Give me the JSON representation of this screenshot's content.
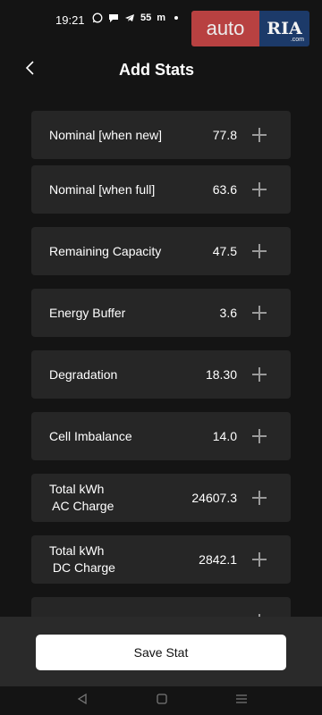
{
  "status_bar": {
    "time": "19:21",
    "network_label": "55",
    "indicator": "m",
    "icons": [
      "whatsapp-icon",
      "chat-bubble-icon",
      "telegram-icon",
      "network-icon",
      "dot-icon"
    ]
  },
  "watermark": {
    "auto_text": "auto",
    "ria_text": "RIA",
    "dotcom_text": ".com"
  },
  "header": {
    "title": "Add Stats",
    "back_icon": "chevron-left-icon"
  },
  "stats": [
    {
      "label": "Nominal [when new]",
      "value": "77.8"
    },
    {
      "label": "Nominal [when full]",
      "value": "63.6"
    },
    {
      "label": "Remaining Capacity",
      "value": "47.5"
    },
    {
      "label": "Energy Buffer",
      "value": "3.6"
    },
    {
      "label": "Degradation",
      "value": "18.30"
    },
    {
      "label": "Cell Imbalance",
      "value": "14.0"
    },
    {
      "label": "Total kWh\n AC Charge",
      "value": "24607.3"
    },
    {
      "label": "Total kWh\n DC Charge",
      "value": "2842.1"
    },
    {
      "label": "",
      "value": ""
    }
  ],
  "save_button": {
    "label": "Save Stat"
  },
  "nav": {
    "back_icon": "triangle-back-icon",
    "home_icon": "square-home-icon",
    "menu_icon": "hamburger-menu-icon"
  },
  "colors": {
    "background": "#141414",
    "card": "#262626",
    "bottom_panel": "#2a2a2a",
    "button": "#ffffff",
    "plus_icon": "#9a9a9a"
  }
}
